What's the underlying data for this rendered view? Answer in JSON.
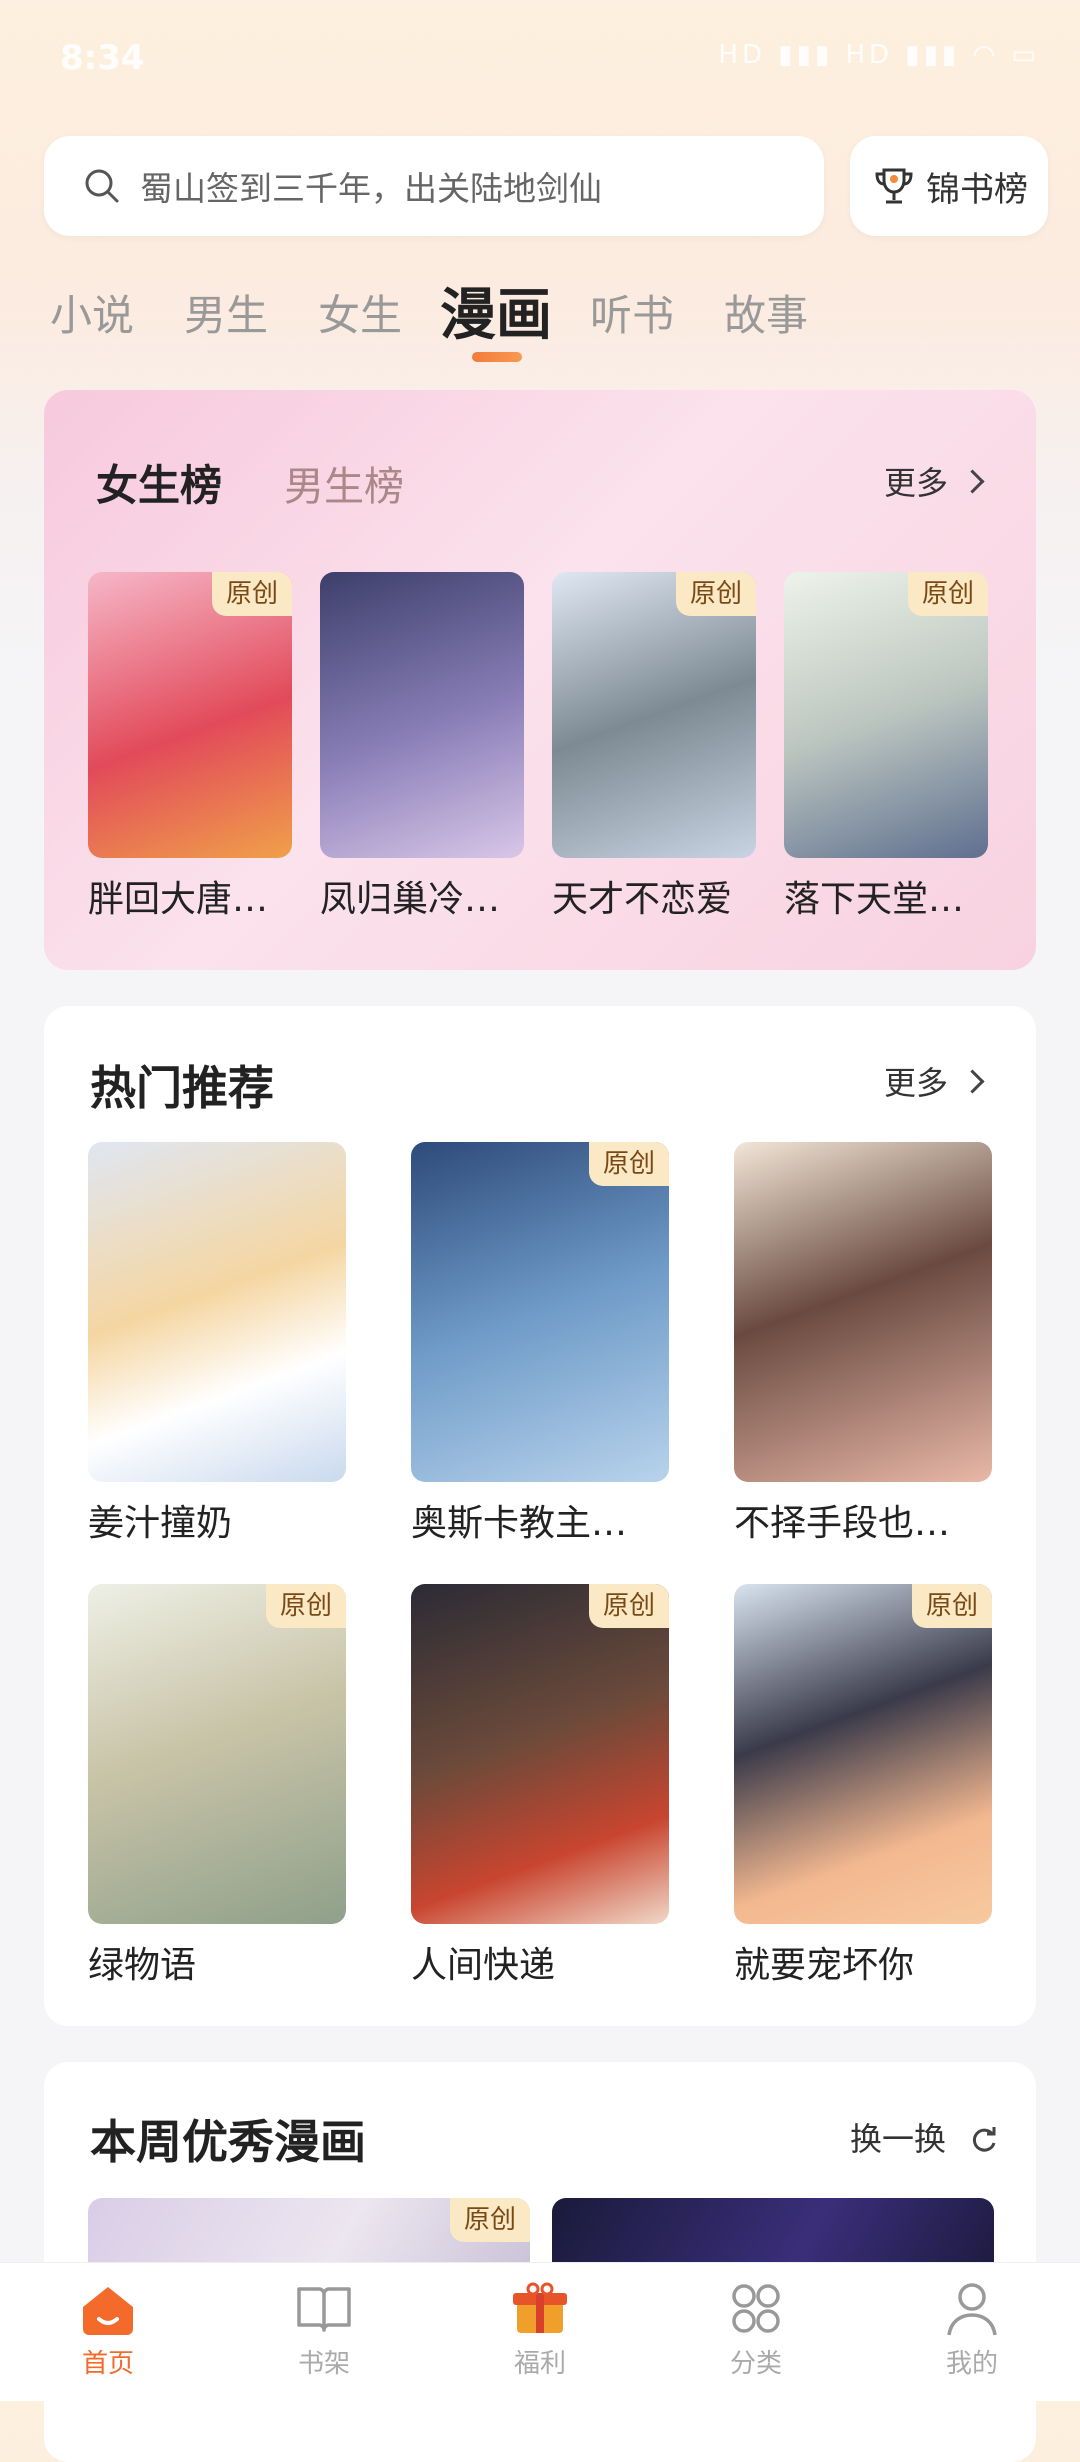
{
  "status_bar": {
    "time": "8:34",
    "icons_text": "HD ▮▮▮ HD ▮▮▮ ◠ ▭"
  },
  "search": {
    "placeholder": "蜀山签到三千年，出关陆地剑仙"
  },
  "rank_button": {
    "label": "锦书榜",
    "icon": "trophy-icon"
  },
  "tabs": [
    {
      "label": "小说"
    },
    {
      "label": "男生"
    },
    {
      "label": "女生"
    },
    {
      "label": "漫画",
      "active": true
    },
    {
      "label": "听书"
    },
    {
      "label": "故事"
    }
  ],
  "ranking": {
    "tab_female": "女生榜",
    "tab_male": "男生榜",
    "more": "更多",
    "items": [
      {
        "title": "胖回大唐…",
        "badge": "原创"
      },
      {
        "title": "凤归巢冷…",
        "badge": ""
      },
      {
        "title": "天才不恋爱",
        "badge": "原创"
      },
      {
        "title": "落下天堂…",
        "badge": "原创"
      }
    ]
  },
  "hot": {
    "title": "热门推荐",
    "more": "更多",
    "items": [
      {
        "title": "姜汁撞奶",
        "badge": ""
      },
      {
        "title": "奥斯卡教主…",
        "badge": "原创"
      },
      {
        "title": "不择手段也…",
        "badge": ""
      },
      {
        "title": "绿物语",
        "badge": "原创"
      },
      {
        "title": "人间快递",
        "badge": "原创"
      },
      {
        "title": "就要宠坏你",
        "badge": "原创"
      }
    ]
  },
  "weekly": {
    "title": "本周优秀漫画",
    "refresh": "换一换",
    "items": [
      {
        "badge": "原创"
      },
      {
        "badge": ""
      }
    ]
  },
  "bottom_nav": [
    {
      "label": "首页",
      "icon": "home-icon",
      "active": true
    },
    {
      "label": "书架",
      "icon": "book-icon"
    },
    {
      "label": "福利",
      "icon": "gift-icon"
    },
    {
      "label": "分类",
      "icon": "grid-icon"
    },
    {
      "label": "我的",
      "icon": "user-icon"
    }
  ],
  "colors": {
    "accent": "#f46a2a",
    "badge_bg": "#fbe8c4",
    "badge_text": "#7a4a16"
  }
}
